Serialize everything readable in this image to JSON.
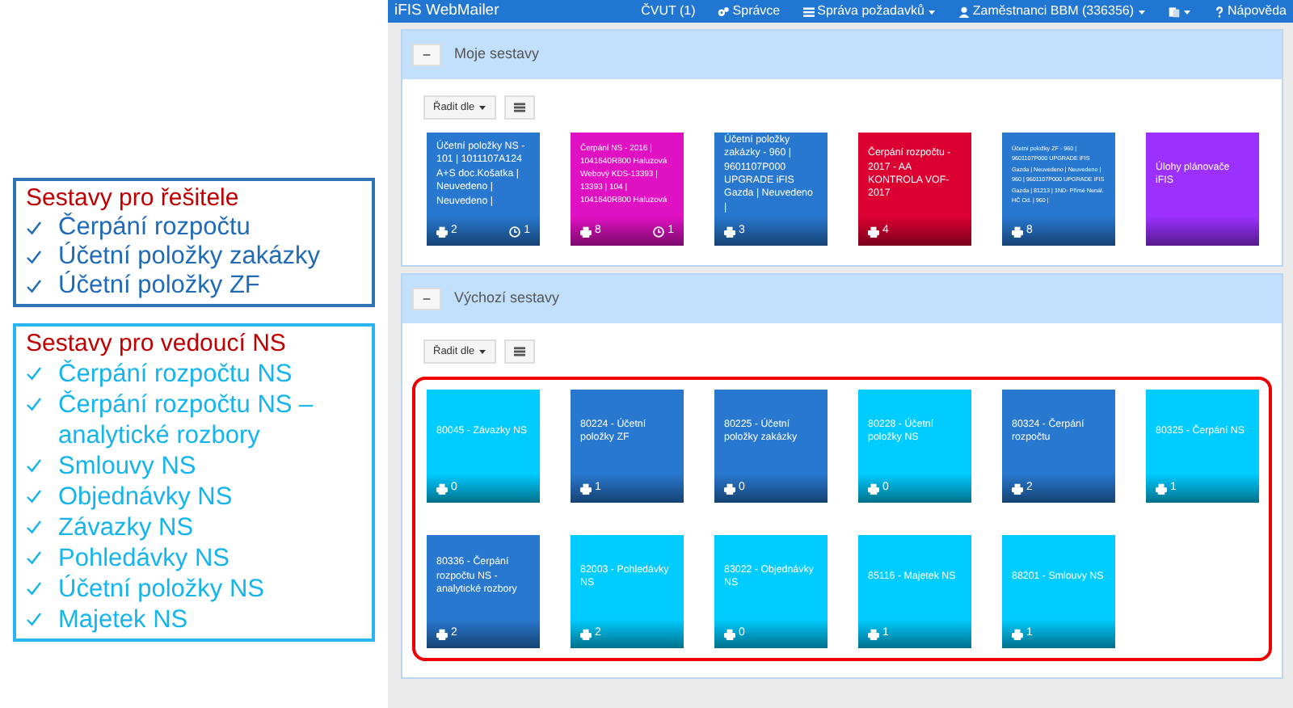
{
  "legend_boxes": [
    {
      "kind": "dark",
      "title": "Sestavy pro řešitele",
      "items": [
        "Čerpání rozpočtu",
        "Účetní položky zakázky",
        "Účetní položky ZF"
      ]
    },
    {
      "kind": "light",
      "title": "Sestavy pro vedoucí NS",
      "items": [
        "Čerpání rozpočtu NS",
        "Čerpání rozpočtu NS –\nanalytické rozbory",
        "Smlouvy NS",
        "Objednávky NS",
        "Závazky NS",
        "Pohledávky NS",
        "Účetní položky NS",
        "Majetek NS"
      ]
    }
  ],
  "navbar": {
    "brand": "iFIS WebMailer",
    "items": [
      {
        "kind": "text",
        "label": "ČVUT (1)"
      },
      {
        "kind": "gear",
        "label": "Správce"
      },
      {
        "kind": "menu",
        "label": "Správa požadavků",
        "dropdown": true
      },
      {
        "kind": "user",
        "label": "Zaměstnanci BBM (336356)",
        "dropdown": true
      },
      {
        "kind": "book",
        "dropdown": true
      },
      {
        "kind": "help",
        "label": "Nápověda"
      }
    ]
  },
  "panels": [
    {
      "title": "Moje sestavy",
      "collapse_symbol": "−",
      "sort_label": "Řadit dle",
      "highlighted": false,
      "tiles": [
        {
          "text": "Účetní položky NS - 101 | 1011107A124 A+S doc.Košatka | Neuvedeno | Neuvedeno |",
          "color": "#2878d0",
          "prints": "2",
          "scheduled": "1"
        },
        {
          "text": "Čerpání NS - 2016 | 1041640R800 Haluzová Webový KDS-13393 | 13393 | 104 | 1041640R800 Haluzová",
          "color": "#e011c2",
          "prints": "8",
          "scheduled": "1"
        },
        {
          "text": "Účetní položky zakázky - 960 | 9601107P000 UPGRADE iFIS Gazda | Neuvedeno |",
          "color": "#2878d0",
          "prints": "3"
        },
        {
          "text": "Čerpání rozpočtu - 2017 - AA KONTROLA VOF-2017",
          "color": "#dc0030",
          "prints": "4"
        },
        {
          "text": "Účetní položky ZF - 960 | 9601107P000 UPGRADE iFIS Gazda | Neuvedeno | Neuvedeno | 960 | 9601107P000 UPGRADE iFIS Gazda | 81213 | 1ND- Přímé Nenál. HČ Od. | 960 |",
          "color": "#2878d0",
          "prints": "8"
        },
        {
          "text": "Úlohy plánovače iFIS",
          "color": "#9b30ff"
        }
      ]
    },
    {
      "title": "Výchozí sestavy",
      "collapse_symbol": "−",
      "sort_label": "Řadit dle",
      "highlighted": true,
      "tiles": [
        {
          "text": "80045 - Závazky NS",
          "color": "#00ccff",
          "prints": "0"
        },
        {
          "text": "80224 - Účetní položky ZF",
          "color": "#2878d0",
          "prints": "1"
        },
        {
          "text": "80225 - Účetní položky zakázky",
          "color": "#2878d0",
          "prints": "0"
        },
        {
          "text": "80228 - Účetní položky NS",
          "color": "#00ccff",
          "prints": "0"
        },
        {
          "text": "80324 - Čerpání rozpočtu",
          "color": "#2878d0",
          "prints": "2"
        },
        {
          "text": "80325 - Čerpání NS",
          "color": "#00ccff",
          "prints": "1"
        },
        {
          "text": "80336 - Čerpání rozpočtu NS - analytické rozbory",
          "color": "#2878d0",
          "prints": "2"
        },
        {
          "text": "82003 - Pohledávky NS",
          "color": "#00ccff",
          "prints": "2"
        },
        {
          "text": "83022 - Objednávky NS",
          "color": "#00ccff",
          "prints": "0"
        },
        {
          "text": "85116 - Majetek NS",
          "color": "#00ccff",
          "prints": "1"
        },
        {
          "text": "88201 - Smlouvy NS",
          "color": "#00ccff",
          "prints": "1"
        }
      ]
    }
  ]
}
